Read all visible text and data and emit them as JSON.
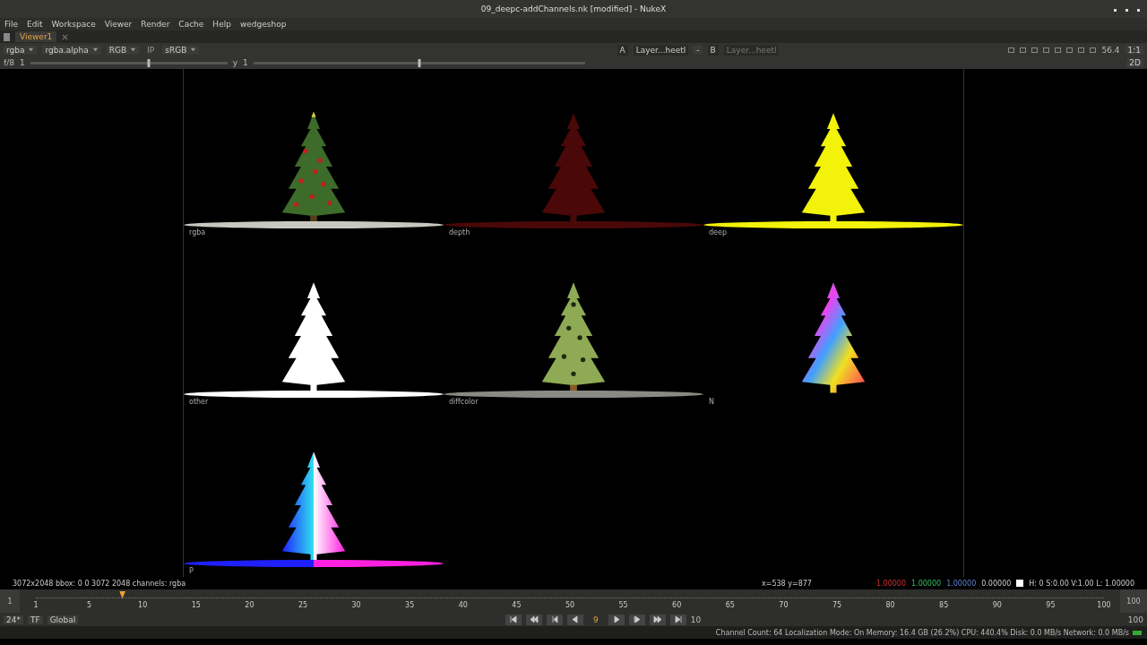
{
  "window": {
    "title": "09_deepc-addChannels.nk [modified] - NukeX"
  },
  "menu": [
    "File",
    "Edit",
    "Workspace",
    "Viewer",
    "Render",
    "Cache",
    "Help",
    "wedgeshop"
  ],
  "tabs": [
    {
      "label": "Viewer1",
      "selected": true
    }
  ],
  "toolbar": {
    "left": [
      {
        "label": "rgba",
        "dropdown": true
      },
      {
        "label": "rgba.alpha",
        "dropdown": true
      },
      {
        "label": "RGB",
        "dropdown": true
      },
      {
        "label": "IP",
        "dropdown": false
      },
      {
        "label": "sRGB",
        "dropdown": true
      }
    ],
    "a_input": "A",
    "a_layer": "Layer...heetl",
    "a_op": "-",
    "b_input": "B",
    "b_layer": "Layer...heetl",
    "zoom": "56.4",
    "ratio": "1:1",
    "view_mode": "2D"
  },
  "gain": {
    "fstop": "f/8",
    "gain": "1",
    "gain_slider": {
      "level": 0.6
    },
    "gamma_label": "y",
    "gamma": "1",
    "gamma_slider": {
      "level": 0.5
    }
  },
  "tiles": [
    {
      "label": "rgba",
      "kind": "natural"
    },
    {
      "label": "depth",
      "kind": "solid",
      "color": "#4a0808"
    },
    {
      "label": "deep",
      "kind": "solid",
      "color": "#f2f20a"
    },
    {
      "label": "other",
      "kind": "solid",
      "color": "#ffffff"
    },
    {
      "label": "diffcolor",
      "kind": "textured",
      "color": "#8faa55"
    },
    {
      "label": "N",
      "kind": "rainbow"
    },
    {
      "label": "P",
      "kind": "split"
    }
  ],
  "info": {
    "format": "3072x2048  bbox: 0 0 3072 2048 channels: rgba",
    "coords": "x=538 y=877",
    "r": "1.00000",
    "g": "1.00000",
    "b": "1.00000",
    "a": "0.00000",
    "hsvl": "H:  0 S:0.00 V:1.00  L: 1.00000"
  },
  "timeline": {
    "start": "1",
    "ticks": [
      "1",
      "5",
      "10",
      "15",
      "20",
      "25",
      "30",
      "35",
      "40",
      "45",
      "50",
      "55",
      "60",
      "65",
      "70",
      "75",
      "80",
      "85",
      "90",
      "95",
      "100"
    ],
    "end": "100",
    "playhead": {
      "level": 0.081
    }
  },
  "transport": {
    "fps": "24*",
    "tf": "TF",
    "scope": "Global",
    "frame": "9",
    "step": "10",
    "end": "100"
  },
  "status_bar": "Channel Count: 64  Localization Mode: On  Memory: 16.4 GB (26.2%) CPU: 440.4% Disk: 0.0 MB/s Network: 0.0 MB/s"
}
